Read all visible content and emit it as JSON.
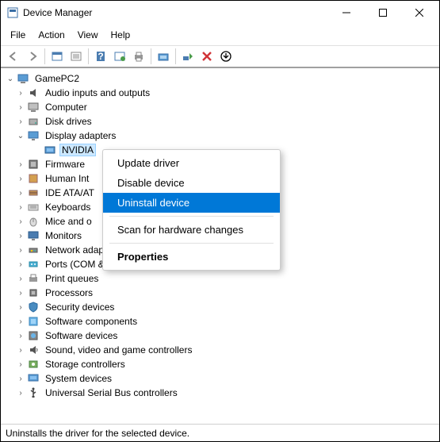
{
  "window": {
    "title": "Device Manager"
  },
  "menu": {
    "file": "File",
    "action": "Action",
    "view": "View",
    "help": "Help"
  },
  "tree": {
    "root": "GamePC2",
    "categories": [
      {
        "label": "Audio inputs and outputs"
      },
      {
        "label": "Computer"
      },
      {
        "label": "Disk drives"
      },
      {
        "label": "Display adapters",
        "expanded": true,
        "children": [
          {
            "label": "NVIDIA",
            "selected": true
          }
        ]
      },
      {
        "label": "Firmware"
      },
      {
        "label": "Human Int"
      },
      {
        "label": "IDE ATA/AT"
      },
      {
        "label": "Keyboards"
      },
      {
        "label": "Mice and o"
      },
      {
        "label": "Monitors"
      },
      {
        "label": "Network adapters"
      },
      {
        "label": "Ports (COM & LPT)"
      },
      {
        "label": "Print queues"
      },
      {
        "label": "Processors"
      },
      {
        "label": "Security devices"
      },
      {
        "label": "Software components"
      },
      {
        "label": "Software devices"
      },
      {
        "label": "Sound, video and game controllers"
      },
      {
        "label": "Storage controllers"
      },
      {
        "label": "System devices"
      },
      {
        "label": "Universal Serial Bus controllers"
      }
    ]
  },
  "context_menu": {
    "update": "Update driver",
    "disable": "Disable device",
    "uninstall": "Uninstall device",
    "scan": "Scan for hardware changes",
    "properties": "Properties"
  },
  "status": "Uninstalls the driver for the selected device."
}
